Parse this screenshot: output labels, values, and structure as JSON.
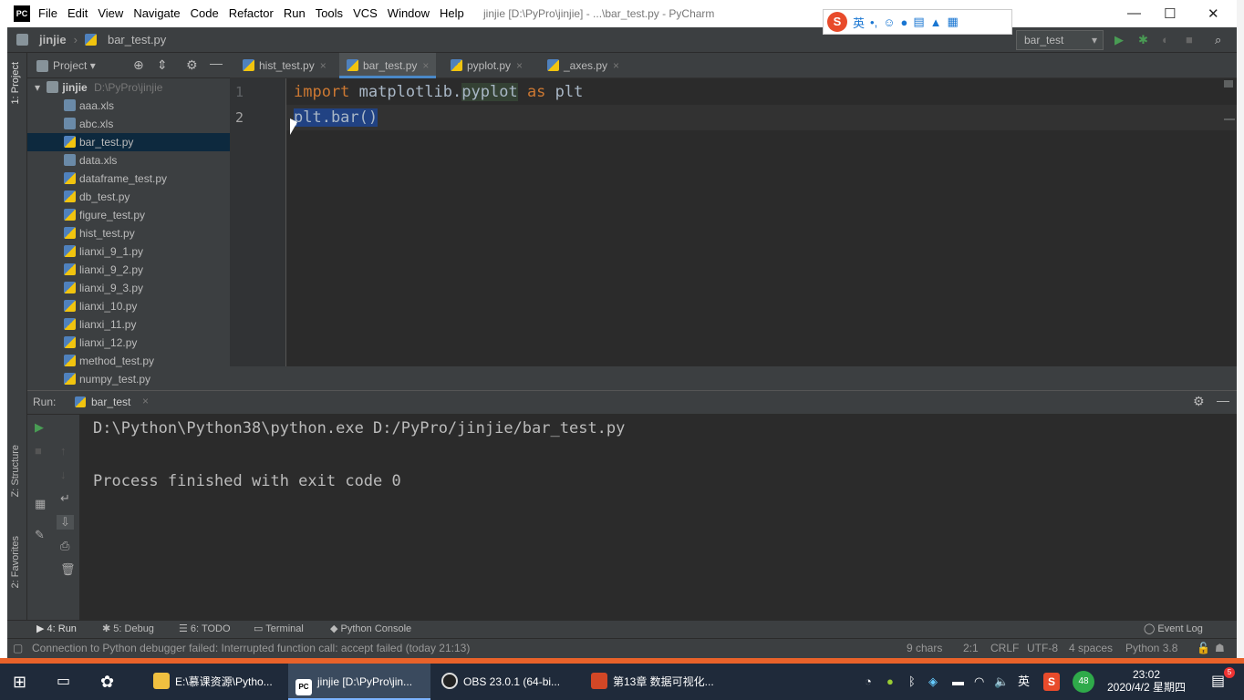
{
  "window": {
    "title": "jinjie [D:\\PyPro\\jinjie] - ...\\bar_test.py - PyCharm",
    "menu": [
      "File",
      "Edit",
      "View",
      "Navigate",
      "Code",
      "Refactor",
      "Run",
      "Tools",
      "VCS",
      "Window",
      "Help"
    ]
  },
  "ime": {
    "label": "英"
  },
  "navbar": {
    "project": "jinjie",
    "file": "bar_test.py",
    "run_config": "bar_test"
  },
  "leftstrip": {
    "project_tab": "1: Project",
    "structure_tab": "Z: Structure",
    "favorites_tab": "2: Favorites"
  },
  "project_panel": {
    "title": "Project",
    "root_name": "jinjie",
    "root_path": "D:\\PyPro\\jinjie",
    "files": [
      "aaa.xls",
      "abc.xls",
      "bar_test.py",
      "data.xls",
      "dataframe_test.py",
      "db_test.py",
      "figure_test.py",
      "hist_test.py",
      "lianxi_9_1.py",
      "lianxi_9_2.py",
      "lianxi_9_3.py",
      "lianxi_10.py",
      "lianxi_11.py",
      "lianxi_12.py",
      "method_test.py",
      "numpy_test.py"
    ],
    "selected": "bar_test.py"
  },
  "editor": {
    "tabs": [
      "hist_test.py",
      "bar_test.py",
      "pyplot.py",
      "_axes.py"
    ],
    "active_tab": "bar_test.py",
    "line_numbers": [
      "1",
      "2"
    ],
    "line1": {
      "kw1": "import",
      "mod": "matplotlib.",
      "mod2": "pyplot",
      "kw2": "as",
      "alias": "plt"
    },
    "line2": "plt.bar()"
  },
  "run_panel": {
    "label": "Run:",
    "tab": "bar_test",
    "output": [
      "D:\\Python\\Python38\\python.exe D:/PyPro/jinjie/bar_test.py",
      "",
      "Process finished with exit code 0"
    ]
  },
  "bottom_tabs": {
    "run": "4: Run",
    "debug": "5: Debug",
    "todo": "6: TODO",
    "terminal": "Terminal",
    "console": "Python Console",
    "event_log": "Event Log"
  },
  "status_bar": {
    "message": "Connection to Python debugger failed: Interrupted function call: accept failed (today 21:13)",
    "chars": "9 chars",
    "position": "2:1",
    "line_sep": "CRLF",
    "encoding": "UTF-8",
    "indent": "4 spaces",
    "interpreter": "Python 3.8"
  },
  "taskbar": {
    "items": [
      "E:\\慕课资源\\Pytho...",
      "jinjie [D:\\PyPro\\jin...",
      "OBS 23.0.1 (64-bi...",
      "第13章 数据可视化..."
    ],
    "tray_lang": "英",
    "clock_time": "23:02",
    "clock_date": "2020/4/2 星期四",
    "badge_48": "48",
    "notif_count": "5"
  },
  "colors": {
    "accent": "#4a88c7",
    "keyword": "#cc7832",
    "selection": "#214283",
    "run_green": "#499c54"
  }
}
